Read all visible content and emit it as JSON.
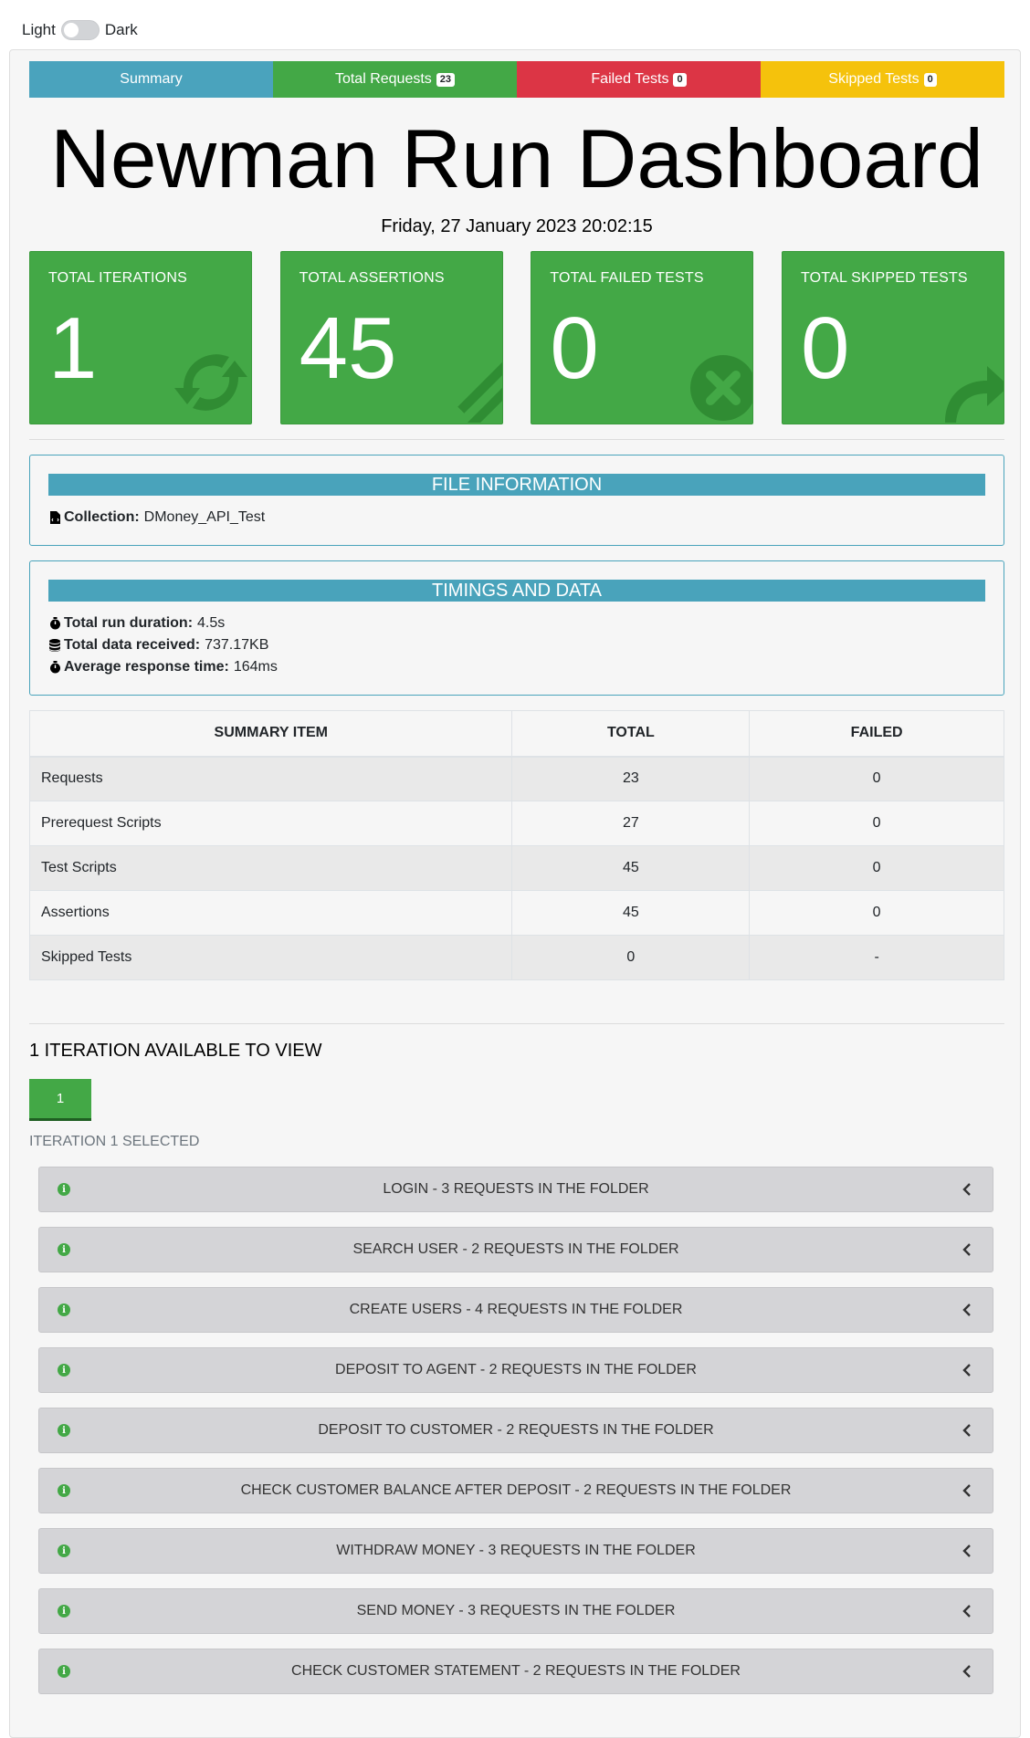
{
  "theme_toggle": {
    "light_label": "Light",
    "dark_label": "Dark"
  },
  "nav": {
    "tabs": [
      {
        "label": "Summary",
        "color": "#4aa3bd"
      },
      {
        "label": "Total Requests",
        "badge": "23",
        "color": "#43a846"
      },
      {
        "label": "Failed Tests",
        "badge": "0",
        "color": "#dc3545"
      },
      {
        "label": "Skipped Tests",
        "badge": "0",
        "color": "#f5c20c"
      }
    ]
  },
  "title": "Newman Run Dashboard",
  "date": "Friday, 27 January 2023 20:02:15",
  "cards": [
    {
      "label": "TOTAL ITERATIONS",
      "value": "1",
      "icon": "sync-icon"
    },
    {
      "label": "TOTAL ASSERTIONS",
      "value": "45",
      "icon": "pencil-ruler-icon"
    },
    {
      "label": "TOTAL FAILED TESTS",
      "value": "0",
      "icon": "times-circle-icon"
    },
    {
      "label": "TOTAL SKIPPED TESTS",
      "value": "0",
      "icon": "share-arrow-icon"
    }
  ],
  "file_info": {
    "heading": "FILE INFORMATION",
    "collection_label": "Collection:",
    "collection_value": "DMoney_API_Test"
  },
  "timings": {
    "heading": "TIMINGS AND DATA",
    "rows": [
      {
        "label": "Total run duration:",
        "value": "4.5s",
        "icon": "stopwatch-icon"
      },
      {
        "label": "Total data received:",
        "value": "737.17KB",
        "icon": "database-icon"
      },
      {
        "label": "Average response time:",
        "value": "164ms",
        "icon": "stopwatch-icon"
      }
    ]
  },
  "summary_table": {
    "headers": [
      "SUMMARY ITEM",
      "TOTAL",
      "FAILED"
    ],
    "rows": [
      [
        "Requests",
        "23",
        "0"
      ],
      [
        "Prerequest Scripts",
        "27",
        "0"
      ],
      [
        "Test Scripts",
        "45",
        "0"
      ],
      [
        "Assertions",
        "45",
        "0"
      ],
      [
        "Skipped Tests",
        "0",
        "-"
      ]
    ]
  },
  "iterations": {
    "heading": "1 ITERATION AVAILABLE TO VIEW",
    "buttons": [
      "1"
    ],
    "selected_text": "ITERATION 1 SELECTED"
  },
  "folders": [
    "LOGIN - 3 REQUESTS IN THE FOLDER",
    "SEARCH USER - 2 REQUESTS IN THE FOLDER",
    "CREATE USERS - 4 REQUESTS IN THE FOLDER",
    "DEPOSIT TO AGENT - 2 REQUESTS IN THE FOLDER",
    "DEPOSIT TO CUSTOMER - 2 REQUESTS IN THE FOLDER",
    "CHECK CUSTOMER BALANCE AFTER DEPOSIT - 2 REQUESTS IN THE FOLDER",
    "WITHDRAW MONEY - 3 REQUESTS IN THE FOLDER",
    "SEND MONEY - 3 REQUESTS IN THE FOLDER",
    "CHECK CUSTOMER STATEMENT - 2 REQUESTS IN THE FOLDER"
  ]
}
